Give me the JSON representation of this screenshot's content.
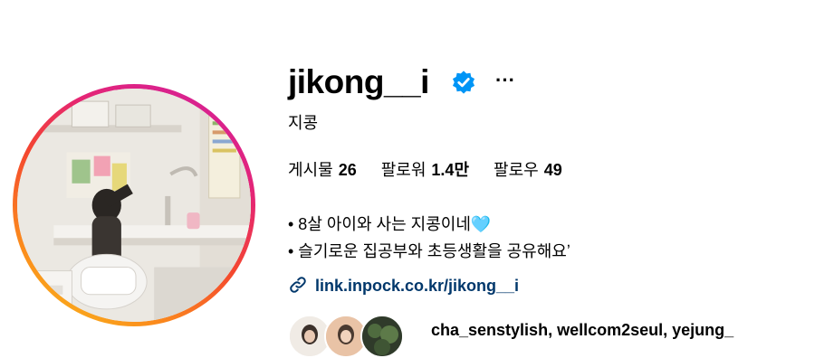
{
  "profile": {
    "username": "jikong__i",
    "full_name": "지콩",
    "verified": true,
    "more_label": "···"
  },
  "stats": [
    {
      "label": "게시물",
      "value": "26"
    },
    {
      "label": "팔로워",
      "value": "1.4만"
    },
    {
      "label": "팔로우",
      "value": "49"
    }
  ],
  "bio": {
    "line1": "• 8살 아이와 사는 지콩이네",
    "line1_emoji": "🩵",
    "line2": "• 슬기로운 집공부와 초등생활을 공유해요ʼ"
  },
  "link": {
    "text": "link.inpock.co.kr/jikong__i",
    "icon": "link-icon"
  },
  "followed_by": {
    "names": "cha_senstylish, wellcom2seul, yejung_"
  },
  "colors": {
    "link": "#00376b",
    "verified_badge": "#0095f6",
    "ring_start": "#f9c71c",
    "ring_end": "#cf1fa4"
  }
}
